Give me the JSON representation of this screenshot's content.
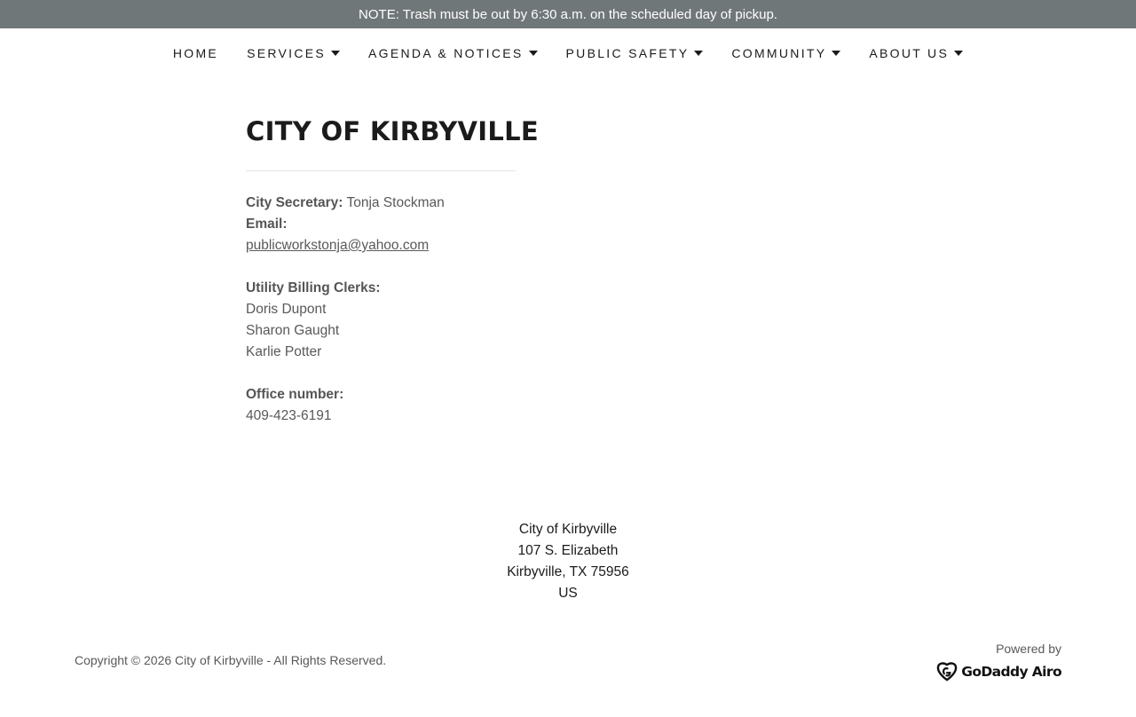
{
  "announcement": "NOTE: Trash must be out by 6:30 a.m. on the scheduled day of pickup.",
  "nav": {
    "items": [
      {
        "label": "HOME"
      },
      {
        "label": "SERVICES"
      },
      {
        "label": "AGENDA & NOTICES"
      },
      {
        "label": "PUBLIC SAFETY"
      },
      {
        "label": "COMMUNITY"
      },
      {
        "label": "ABOUT US"
      }
    ]
  },
  "main": {
    "title": "CITY OF KIRBYVILLE",
    "secretary_label": "City Secretary:",
    "secretary_name": " Tonja Stockman",
    "email_label": "Email:",
    "email": "publicworkstonja@yahoo.com",
    "clerks_label": "Utility Billing Clerks:",
    "clerks": [
      "Doris Dupont",
      "Sharon Gaught",
      "Karlie Potter"
    ],
    "office_label": "Office number:",
    "office_number": "409-423-6191"
  },
  "footer": {
    "address": [
      "City of Kirbyville",
      "107 S. Elizabeth",
      "Kirbyville, TX 75956",
      "US"
    ],
    "copyright": "Copyright © 2026 City of Kirbyville - All Rights Reserved.",
    "powered_by": "Powered by",
    "brand": "GoDaddy Airo"
  },
  "icons": {
    "caret": "caret-down-icon",
    "brand_logo": "godaddy-logo-icon"
  },
  "colors": {
    "announcement_bg": "#707779",
    "text": "#1b1b1b",
    "muted_text": "#595959"
  }
}
